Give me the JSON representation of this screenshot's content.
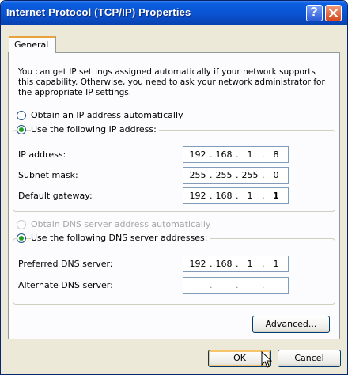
{
  "window": {
    "title": "Internet Protocol (TCP/IP) Properties",
    "help_label": "?"
  },
  "tab": {
    "label": "General"
  },
  "description": "You can get IP settings assigned automatically if your network supports this capability. Otherwise, you need to ask your network administrator for the appropriate IP settings.",
  "ip_mode": {
    "auto_label": "Obtain an IP address automatically",
    "manual_label": "Use the following IP address:",
    "selected": "manual"
  },
  "ip_fields": {
    "ip_label": "IP address:",
    "ip_octets": [
      "192",
      "168",
      "1",
      "8"
    ],
    "subnet_label": "Subnet mask:",
    "subnet_octets": [
      "255",
      "255",
      "255",
      "0"
    ],
    "gateway_label": "Default gateway:",
    "gateway_octets": [
      "192",
      "168",
      "1",
      "1"
    ]
  },
  "dns_mode": {
    "auto_label": "Obtain DNS server address automatically",
    "manual_label": "Use the following DNS server addresses:",
    "selected": "manual"
  },
  "dns_fields": {
    "preferred_label": "Preferred DNS server:",
    "preferred_octets": [
      "192",
      "168",
      "1",
      "1"
    ],
    "alternate_label": "Alternate DNS server:",
    "alternate_octets": [
      "",
      "",
      "",
      ""
    ]
  },
  "buttons": {
    "advanced": "Advanced...",
    "ok": "OK",
    "cancel": "Cancel"
  }
}
